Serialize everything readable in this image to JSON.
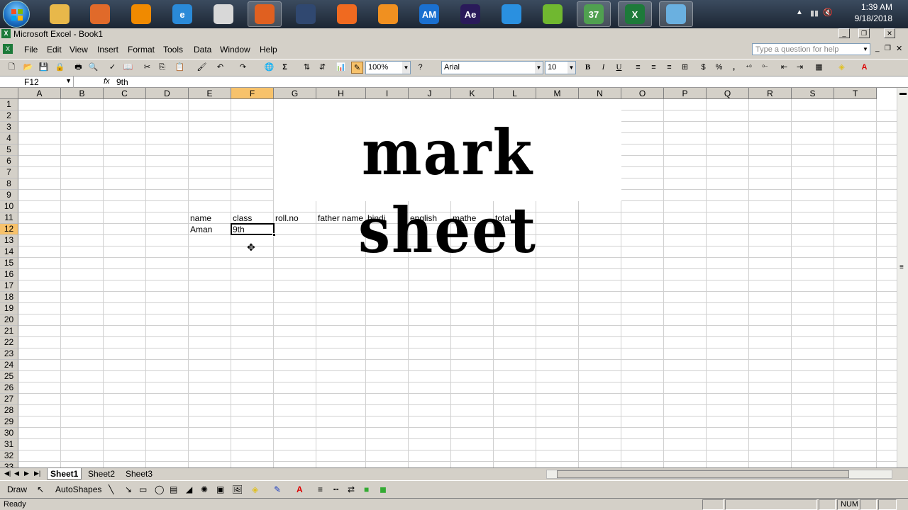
{
  "taskbar": {
    "apps": [
      {
        "name": "file-explorer",
        "label": ""
      },
      {
        "name": "media-player",
        "label": ""
      },
      {
        "name": "vlc",
        "label": ""
      },
      {
        "name": "internet-explorer",
        "label": "e"
      },
      {
        "name": "chrome",
        "label": ""
      },
      {
        "name": "recorder",
        "label": ""
      },
      {
        "name": "media-app",
        "label": ""
      },
      {
        "name": "firefox",
        "label": ""
      },
      {
        "name": "uc-browser",
        "label": ""
      },
      {
        "name": "aimp",
        "label": "AM"
      },
      {
        "name": "after-effects",
        "label": "Ae"
      },
      {
        "name": "sync-app",
        "label": ""
      },
      {
        "name": "bluestacks",
        "label": ""
      },
      {
        "name": "clapper-app",
        "label": "37"
      },
      {
        "name": "excel",
        "label": "X"
      },
      {
        "name": "notepad",
        "label": ""
      }
    ],
    "clock_time": "1:39 AM",
    "clock_date": "9/18/2018"
  },
  "window": {
    "title": "Microsoft Excel - Book1"
  },
  "menu": {
    "items": [
      "File",
      "Edit",
      "View",
      "Insert",
      "Format",
      "Tools",
      "Data",
      "Window",
      "Help"
    ],
    "help_placeholder": "Type a question for help"
  },
  "toolbar": {
    "zoom": "100%",
    "font": "Arial",
    "font_size": "10",
    "bold": "B",
    "italic": "I",
    "underline": "U",
    "currency": "$",
    "percent": "%",
    "comma": ","
  },
  "formula_bar": {
    "name_box": "F12",
    "fx": "fx",
    "value": "9th"
  },
  "grid": {
    "columns": [
      "A",
      "B",
      "C",
      "D",
      "E",
      "F",
      "G",
      "H",
      "I",
      "J",
      "K",
      "L",
      "M",
      "N",
      "O",
      "P",
      "Q",
      "R",
      "S",
      "T"
    ],
    "rows": [
      "1",
      "2",
      "3",
      "4",
      "5",
      "6",
      "7",
      "8",
      "9",
      "10",
      "11",
      "12",
      "13",
      "14",
      "15",
      "16",
      "17",
      "18",
      "19",
      "20",
      "21",
      "22",
      "23",
      "24",
      "25",
      "26",
      "27",
      "28",
      "29",
      "30",
      "31",
      "32",
      "33"
    ],
    "selected_column": "F",
    "selected_row": "12",
    "title": "mark sheet",
    "header_row": [
      "name",
      "class",
      "roll.no",
      "father name",
      "hindi",
      "english",
      "mathe",
      "total"
    ],
    "data_row": [
      "Aman",
      "9th"
    ]
  },
  "sheets": {
    "tabs": [
      "Sheet1",
      "Sheet2",
      "Sheet3"
    ],
    "active": "Sheet1"
  },
  "drawing": {
    "draw_label": "Draw",
    "autoshapes_label": "AutoShapes"
  },
  "status": {
    "text": "Ready",
    "num": "NUM"
  }
}
